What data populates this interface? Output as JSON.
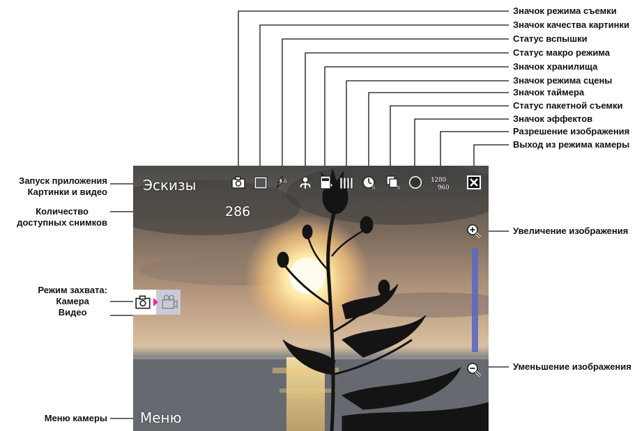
{
  "screen": {
    "softkey_left": "Эскизы",
    "shots_count": "286",
    "softkey_menu": "Меню",
    "resolution_top": "1280",
    "resolution_bottom": "960"
  },
  "callouts": {
    "capture_mode_icon": "Значок режима съемки",
    "picture_quality_icon": "Значок качества картинки",
    "flash_status": "Статус вспышки",
    "macro_status": "Статус макро режима",
    "storage_icon": "Значок хранилища",
    "scene_mode_icon": "Значок режима сцены",
    "timer_icon": "Значок таймера",
    "burst_status": "Статус пакетной съемки",
    "effects_icon": "Значок эффектов",
    "image_resolution": "Разрешение изображения",
    "exit_camera": "Выход из режима камеры",
    "zoom_in": "Увеличение изображения",
    "zoom_out": "Уменьшение изображения",
    "launch_app_line1": "Запуск приложения",
    "launch_app_line2": "Картинки и видео",
    "shots_line1": "Количество",
    "shots_line2": "доступных снимков",
    "capture_mode_label": "Режим захвата:",
    "camera": "Камера",
    "video": "Видео",
    "camera_menu": "Меню камеры"
  },
  "icons": [
    "camera-mode-icon",
    "picture-quality-icon",
    "flash-auto-icon",
    "macro-icon",
    "storage-card-icon",
    "scene-mode-icon",
    "timer-icon",
    "burst-icon",
    "effects-icon",
    "resolution-icon",
    "close-icon",
    "zoom-in-icon",
    "zoom-out-icon",
    "video-camera-icon"
  ],
  "colors": {
    "zoom_bar": "#5d6bc0",
    "mode_arrow": "#e0309a",
    "label_text": "#111111"
  }
}
